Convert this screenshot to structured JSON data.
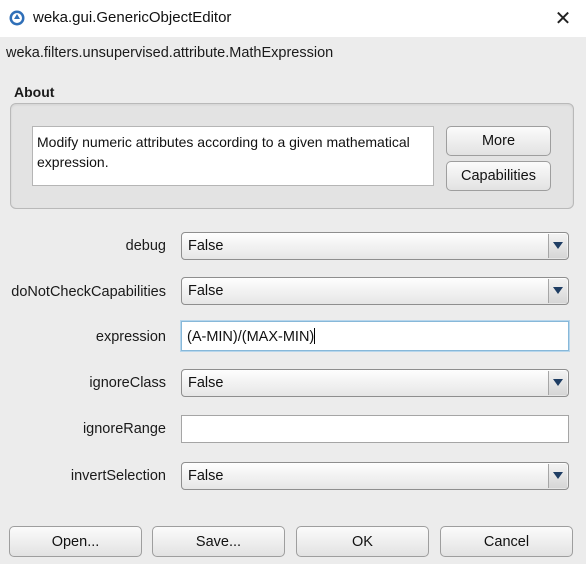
{
  "window": {
    "title": "weka.gui.GenericObjectEditor",
    "close_glyph": "✕"
  },
  "class_name": "weka.filters.unsupervised.attribute.MathExpression",
  "about": {
    "label": "About",
    "description_line1": "Modify numeric attributes according to a given mathematical",
    "description_line2": "expression.",
    "more_label": "More",
    "capabilities_label": "Capabilities"
  },
  "properties": {
    "debug": {
      "label": "debug",
      "value": "False"
    },
    "doNotCheckCapabilities": {
      "label": "doNotCheckCapabilities",
      "value": "False"
    },
    "expression": {
      "label": "expression",
      "value": "(A-MIN)/(MAX-MIN)"
    },
    "ignoreClass": {
      "label": "ignoreClass",
      "value": "False"
    },
    "ignoreRange": {
      "label": "ignoreRange",
      "value": ""
    },
    "invertSelection": {
      "label": "invertSelection",
      "value": "False"
    }
  },
  "buttons": {
    "open": "Open...",
    "save": "Save...",
    "ok": "OK",
    "cancel": "Cancel"
  },
  "colors": {
    "accent": "#3b7fc4",
    "background": "#ececec"
  }
}
